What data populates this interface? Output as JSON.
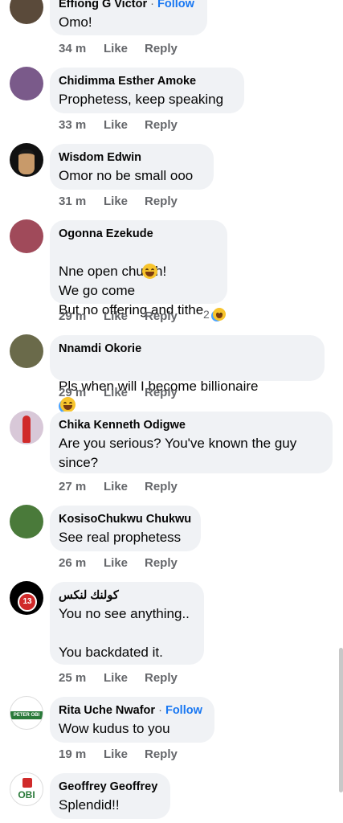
{
  "comments": [
    {
      "name": "Effiong G Victor",
      "follow": "Follow",
      "text": "Omo!",
      "time": "34 m",
      "like": "Like",
      "reply": "Reply",
      "avatar_color": "#5a4a3a"
    },
    {
      "name": "Chidimma Esther Amoke",
      "text": "Prophetess, keep speaking",
      "time": "33 m",
      "like": "Like",
      "reply": "Reply",
      "avatar_color": "#7a5a8a"
    },
    {
      "name": "Wisdom Edwin",
      "text": "Omor no be small ooo",
      "time": "31 m",
      "like": "Like",
      "reply": "Reply",
      "avatar_color": "#111111"
    },
    {
      "name": "Ogonna Ezekude",
      "text": "Nne open church!\nWe go come\nBut no offering and tithe",
      "time": "29 m",
      "like": "Like",
      "reply": "Reply",
      "reaction_count": "2",
      "avatar_color": "#a04a5a"
    },
    {
      "name": "Nnamdi Okorie",
      "text": "Pls when will I become billionaire",
      "time": "29 m",
      "like": "Like",
      "reply": "Reply",
      "avatar_color": "#6a6a4a"
    },
    {
      "name": "Chika Kenneth Odigwe",
      "text": "Are you serious? You've known the guy\nsince?",
      "time": "27 m",
      "like": "Like",
      "reply": "Reply",
      "avatar_color": "#c8b8c8"
    },
    {
      "name": "KosisoChukwu Chukwu",
      "text": "See real prophetess",
      "time": "26 m",
      "like": "Like",
      "reply": "Reply",
      "avatar_color": "#4a7a3a"
    },
    {
      "name": "كولنك لنكس",
      "text": "You no see anything..\n\nYou backdated it.",
      "time": "25 m",
      "like": "Like",
      "reply": "Reply",
      "avatar_color": "#000000",
      "avatar_badge": "13"
    },
    {
      "name": "Rita Uche Nwafor",
      "follow": "Follow",
      "text": "Wow kudus to you",
      "time": "19 m",
      "like": "Like",
      "reply": "Reply",
      "avatar_color": "#2a7a3a",
      "avatar_label": "PETER OBI"
    },
    {
      "name": "Geoffrey Geoffrey",
      "text": "Splendid!!",
      "avatar_color": "#ffffff",
      "avatar_label": "OBI"
    }
  ],
  "colors": {
    "bubble": "#f0f2f5",
    "meta": "#65676b",
    "link": "#1877f2"
  }
}
